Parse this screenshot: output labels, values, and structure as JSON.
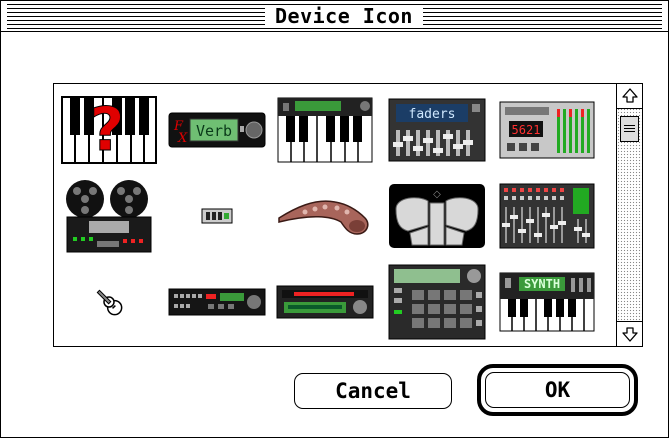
{
  "window": {
    "title": "Device Icon"
  },
  "icons": [
    {
      "name": "unknown-keyboard-icon"
    },
    {
      "name": "fx-verb-unit-icon",
      "label_fx": "F",
      "label_x": "X",
      "label": "Verb"
    },
    {
      "name": "keyboard-synth-icon"
    },
    {
      "name": "faders-unit-icon",
      "label": "faders"
    },
    {
      "name": "sampler-unit-icon",
      "label": "5621"
    },
    {
      "name": "tape-deck-icon"
    },
    {
      "name": "small-module-icon"
    },
    {
      "name": "saxophone-icon"
    },
    {
      "name": "drum-pad-icon",
      "label": "◇"
    },
    {
      "name": "mixer-icon"
    },
    {
      "name": "guitar-icon"
    },
    {
      "name": "rack-unit-icon"
    },
    {
      "name": "green-rack-unit-icon"
    },
    {
      "name": "drum-machine-icon"
    },
    {
      "name": "synth-keyboard-icon",
      "label": "SYNTH"
    }
  ],
  "buttons": {
    "cancel": "Cancel",
    "ok": "OK"
  },
  "colors": {
    "accent_red": "#e00000",
    "lcd_green": "#3a9a3a",
    "lcd_text": "#0a5a2a"
  }
}
